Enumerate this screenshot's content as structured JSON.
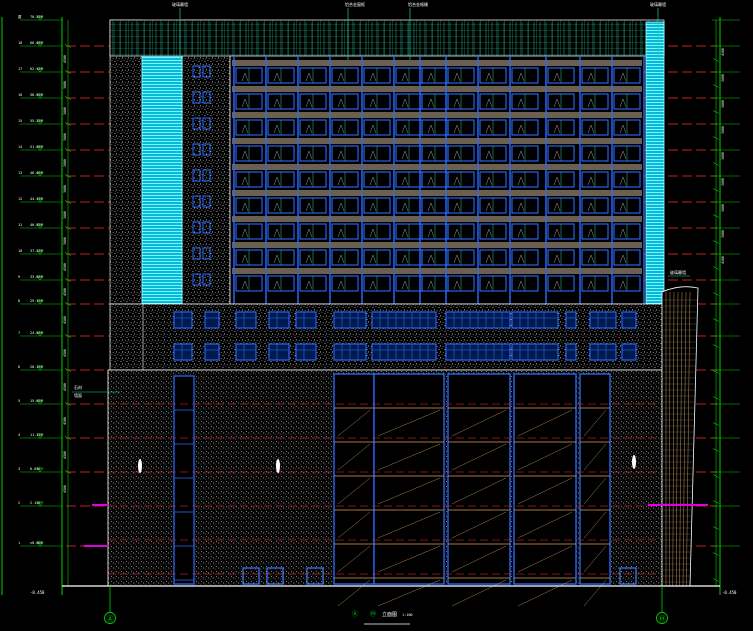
{
  "drawing": {
    "top_callouts": [
      "玻璃幕墙",
      "铝合金窗框",
      "铝合金格栅",
      "玻璃幕墙"
    ],
    "right_callout": "玻璃幕墙",
    "left_callout": [
      "石材",
      "墙面"
    ],
    "axis_start": "Ⓐ",
    "axis_end": "Ⓜ",
    "title_marks": [
      "Ⓐ",
      "Ⓜ"
    ],
    "title": "立面图",
    "scale": "1:100",
    "levels": [
      {
        "num": "屋",
        "elev": "70.550"
      },
      {
        "num": "18",
        "elev": "66.050"
      },
      {
        "num": "17",
        "elev": "62.450"
      },
      {
        "num": "16",
        "elev": "58.850"
      },
      {
        "num": "15",
        "elev": "55.250"
      },
      {
        "num": "14",
        "elev": "51.650"
      },
      {
        "num": "13",
        "elev": "48.050"
      },
      {
        "num": "12",
        "elev": "44.450"
      },
      {
        "num": "11",
        "elev": "40.850"
      },
      {
        "num": "10",
        "elev": "37.250"
      },
      {
        "num": "9",
        "elev": "33.650"
      },
      {
        "num": "8",
        "elev": "29.150"
      },
      {
        "num": "7",
        "elev": "24.650"
      },
      {
        "num": "6",
        "elev": "20.150"
      },
      {
        "num": "5",
        "elev": "15.650"
      },
      {
        "num": "4",
        "elev": "11.150"
      },
      {
        "num": "3",
        "elev": "6.650"
      },
      {
        "num": "2",
        "elev": "2.150"
      },
      {
        "num": "1",
        "elev": "±0.000"
      }
    ],
    "base_elev": "-0.450",
    "dims_left": [
      "4500",
      "3600",
      "3600",
      "3600",
      "3600",
      "3600",
      "3600",
      "3600",
      "4500",
      "4500",
      "4500",
      "4500",
      "4500",
      "4500",
      "4500",
      "4500"
    ],
    "dims_right": [
      "4500",
      "3600",
      "3600",
      "3600",
      "3600",
      "3600",
      "3600",
      "3600",
      "4500"
    ]
  }
}
